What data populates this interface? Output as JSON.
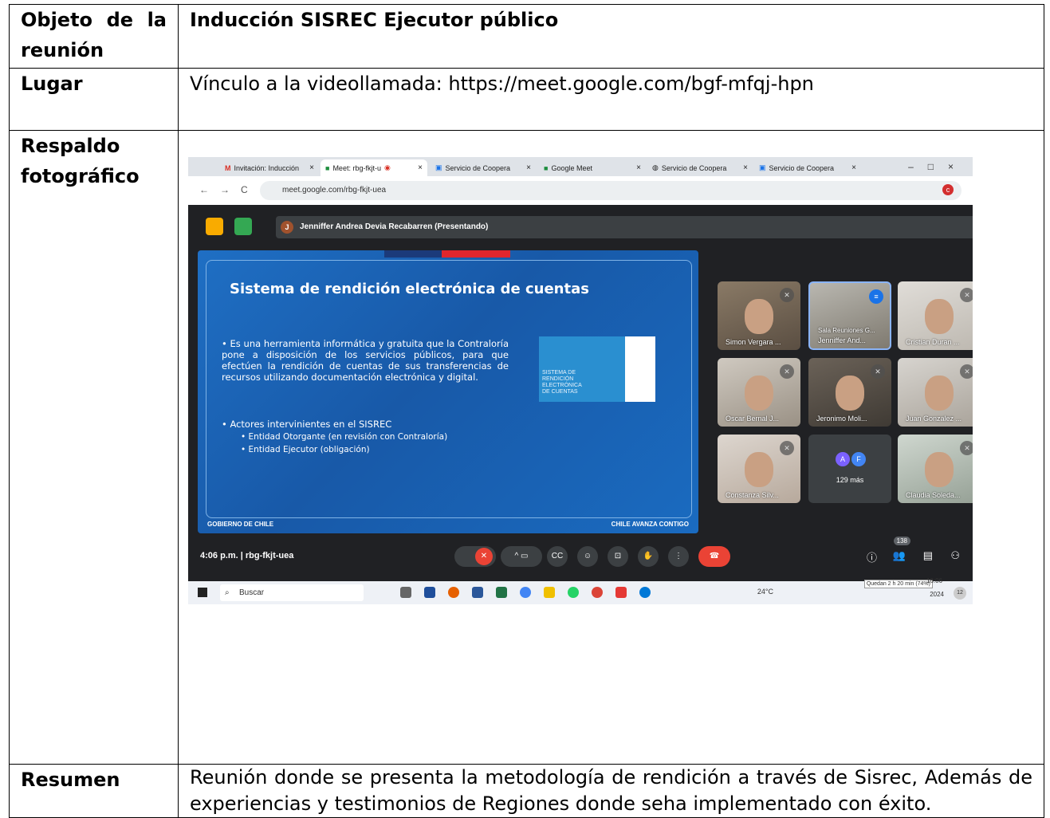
{
  "table": {
    "row1": {
      "label": "Objeto de la reunión",
      "value": "Inducción SISREC Ejecutor público"
    },
    "row2": {
      "label": "Lugar",
      "value": "Vínculo a la videollamada: https://meet.google.com/bgf-mfqj-hpn"
    },
    "row3": {
      "label": "Respaldo fotográfico"
    },
    "row4": {
      "label": "Resumen",
      "value": "Reunión donde se presenta la metodología de rendición a través de Sisrec, Además de experiencias y testimonios de Regiones donde seha implementado con éxito."
    }
  },
  "screenshot": {
    "tabs": [
      "Invitación: Inducción",
      "Meet: rbg-fkjt-u",
      "Servicio de Coopera",
      "Google Meet",
      "Servicio de Coopera",
      "Servicio de Coopera"
    ],
    "url": "meet.google.com/rbg-fkjt-uea",
    "presenter": "Jenniffer Andrea Devia Recabarren (Presentando)",
    "presenter_initial": "J",
    "slide": {
      "title": "Sistema de rendición electrónica de cuentas",
      "bullet1": "• Es una herramienta informática y gratuita que la Contraloría pone a disposición de los servicios públicos, para que efectúen la rendición de cuentas de sus transferencias de recursos utilizando documentación electrónica y digital.",
      "bullet2": "• Actores intervinientes en el SISREC",
      "sub1": "• Entidad Otorgante (en revisión con Contraloría)",
      "sub2": "• Entidad Ejecutor (obligación)",
      "logo_text": "SISTEMA DE RENDICIÓN ELECTRÓNICA DE CUENTAS",
      "footer_left": "GOBIERNO DE CHILE",
      "footer_right": "CHILE AVANZA CONTIGO"
    },
    "participants": [
      "Simon Vergara ...",
      "Jenniffer And...",
      "Cristian Duran ...",
      "Oscar Bernal J...",
      "Jeronimo Moli...",
      "Juan Gonzalez ...",
      "Constanza Silv...",
      "129 más",
      "Claudia Soleda..."
    ],
    "sala_label": "Sala Reuniones G...",
    "more_initials": [
      "A",
      "F"
    ],
    "time_meeting": "4:06 p.m.  |  rbg-fkjt-uea",
    "participant_count": "138",
    "taskbar_search": "Buscar",
    "weather": "24°C",
    "clock": "16:06",
    "year": "2024",
    "battery": "Quedan 2 h 20 min (74%)",
    "notif": "12"
  }
}
